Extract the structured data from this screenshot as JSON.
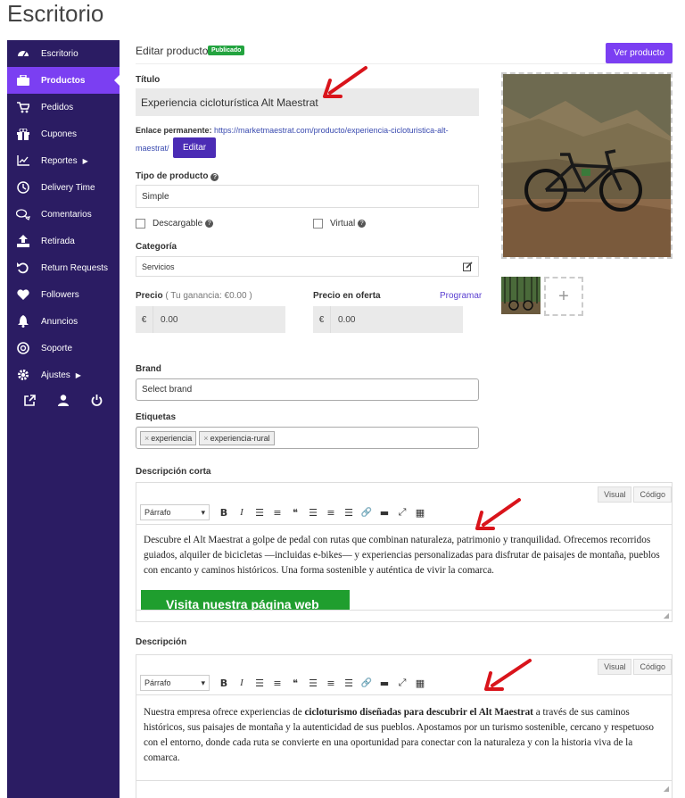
{
  "page_title": "Escritorio",
  "sidebar": {
    "items": [
      {
        "label": "Escritorio",
        "icon": "dashboard-icon"
      },
      {
        "label": "Productos",
        "icon": "briefcase-icon",
        "active": true
      },
      {
        "label": "Pedidos",
        "icon": "cart-icon"
      },
      {
        "label": "Cupones",
        "icon": "gift-icon"
      },
      {
        "label": "Reportes",
        "icon": "chart-line-icon",
        "caret": "▶"
      },
      {
        "label": "Delivery Time",
        "icon": "clock-icon"
      },
      {
        "label": "Comentarios",
        "icon": "comments-icon"
      },
      {
        "label": "Retirada",
        "icon": "upload-icon"
      },
      {
        "label": "Return Requests",
        "icon": "undo-icon"
      },
      {
        "label": "Followers",
        "icon": "heart-icon"
      },
      {
        "label": "Anuncios",
        "icon": "bell-icon"
      },
      {
        "label": "Soporte",
        "icon": "lifebuoy-icon"
      },
      {
        "label": "Ajustes",
        "icon": "gear-icon",
        "caret": "▶"
      }
    ],
    "bottom_icons": [
      "external-link-icon",
      "user-icon",
      "power-icon"
    ]
  },
  "header": {
    "edit_title": "Editar producto",
    "status_badge": "Publicado",
    "view_button": "Ver producto"
  },
  "form": {
    "title_label": "Título",
    "title_value": "Experiencia cicloturística Alt Maestrat",
    "permalink_label": "Enlace permanente:",
    "permalink_url_1": "https://marketmaestrat.com/producto/experiencia-cicloturistica-alt-",
    "permalink_url_2": "maestrat/",
    "edit_button": "Editar",
    "product_type_label": "Tipo de producto",
    "product_type_value": "Simple",
    "downloadable_label": "Descargable",
    "virtual_label": "Virtual",
    "category_label": "Categoría",
    "category_value": "Servicios",
    "price_label": "Precio",
    "price_earning": "( Tu ganancia: €0.00 )",
    "price_currency": "€",
    "price_value": "0.00",
    "sale_price_label": "Precio en oferta",
    "schedule_link": "Programar",
    "sale_currency": "€",
    "sale_value": "0.00",
    "brand_label": "Brand",
    "brand_placeholder": "Select brand",
    "tags_label": "Etiquetas",
    "tags": [
      "experiencia",
      "experiencia-rural"
    ],
    "tag_remove": "×"
  },
  "short_description": {
    "label": "Descripción corta",
    "tab_visual": "Visual",
    "tab_code": "Código",
    "format": "Párrafo",
    "text": "Descubre el Alt Maestrat a golpe de pedal con rutas que combinan naturaleza, patrimonio y tranquilidad. Ofrecemos recorridos guiados, alquiler de bicicletas —incluidas e-bikes— y experiencias personalizadas para disfrutar de paisajes de montaña, pueblos con encanto y caminos históricos. Una forma sostenible y auténtica de vivir la comarca.",
    "button_text": "Visita nuestra página web"
  },
  "description": {
    "label": "Descripción",
    "tab_visual": "Visual",
    "tab_code": "Código",
    "format": "Párrafo",
    "text_before": "Nuestra empresa ofrece experiencias de ",
    "text_bold": "cicloturismo diseñadas para descubrir el Alt Maestrat",
    "text_after": " a través de sus caminos históricos, sus paisajes de montaña y la autenticidad de sus pueblos. Apostamos por un turismo sostenible, cercano y respetuoso con el entorno, donde cada ruta se convierte en una oportunidad para conectar con la naturaleza y con la historia viva de la comarca."
  },
  "toolbar_icons": [
    "bold-icon",
    "italic-icon",
    "bullet-list-icon",
    "numbered-list-icon",
    "blockquote-icon",
    "align-left-icon",
    "align-center-icon",
    "align-right-icon",
    "link-icon",
    "more-icon",
    "fullscreen-icon",
    "kitchen-sink-icon"
  ],
  "toolbar_glyphs": [
    "B",
    "I",
    "☰",
    "≡",
    "❝",
    "☰",
    "≡",
    "☰",
    "🔗",
    "▬",
    "⤢",
    "▦"
  ],
  "colors": {
    "sidebar_bg": "#2b1c63",
    "accent": "#7b3ff2",
    "edit_button": "#4b2cb5",
    "badge": "#23a33f",
    "arrow": "#d9141b"
  }
}
